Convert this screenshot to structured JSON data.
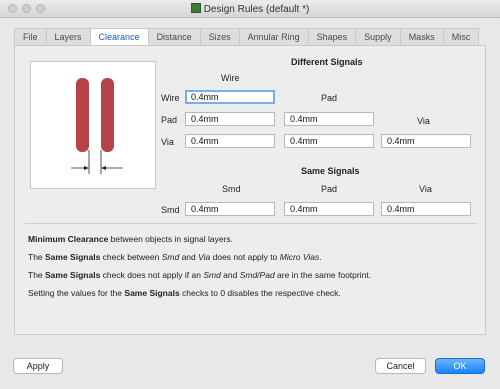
{
  "window": {
    "title": "Design Rules (default *)"
  },
  "tabs": [
    {
      "label": "File"
    },
    {
      "label": "Layers"
    },
    {
      "label": "Clearance"
    },
    {
      "label": "Distance"
    },
    {
      "label": "Sizes"
    },
    {
      "label": "Annular Ring"
    },
    {
      "label": "Shapes"
    },
    {
      "label": "Supply"
    },
    {
      "label": "Masks"
    },
    {
      "label": "Misc"
    }
  ],
  "different_signals": {
    "header": "Different Signals",
    "col_wire": "Wire",
    "col_pad": "Pad",
    "col_via": "Via",
    "row_wire": "Wire",
    "row_pad": "Pad",
    "row_via": "Via",
    "wire_wire": "0.4mm",
    "pad_wire": "0.4mm",
    "pad_pad": "0.4mm",
    "via_wire": "0.4mm",
    "via_pad": "0.4mm",
    "via_via": "0.4mm"
  },
  "same_signals": {
    "header": "Same Signals",
    "col_smd": "Smd",
    "col_pad": "Pad",
    "col_via": "Via",
    "row_smd": "Smd",
    "smd_smd": "0.4mm",
    "smd_pad": "0.4mm",
    "smd_via": "0.4mm"
  },
  "info": {
    "line1_bold": "Minimum Clearance",
    "line1_rest": " between objects in signal layers.",
    "line2_a": "The ",
    "line2_bold": "Same Signals",
    "line2_b": " check between ",
    "line2_i1": "Smd",
    "line2_c": " and ",
    "line2_i2": "Via",
    "line2_d": " does not apply to ",
    "line2_i3": "Micro Vias",
    "line2_e": ".",
    "line3_a": "The ",
    "line3_bold": "Same Signals",
    "line3_b": " check does not apply if an ",
    "line3_i1": "Smd",
    "line3_c": " and ",
    "line3_i2": "Smd/Pad",
    "line3_d": " are in the same footprint.",
    "line4_a": "Setting the values for the ",
    "line4_bold": "Same Signals",
    "line4_b": " checks to 0 disables the respective check."
  },
  "buttons": {
    "apply": "Apply",
    "cancel": "Cancel",
    "ok": "OK"
  },
  "colors": {
    "trace": "#b8424a",
    "tab_active_text": "#1a5fb4",
    "ok_button": "#1a82fb",
    "focus_ring": "#7aaee8"
  }
}
